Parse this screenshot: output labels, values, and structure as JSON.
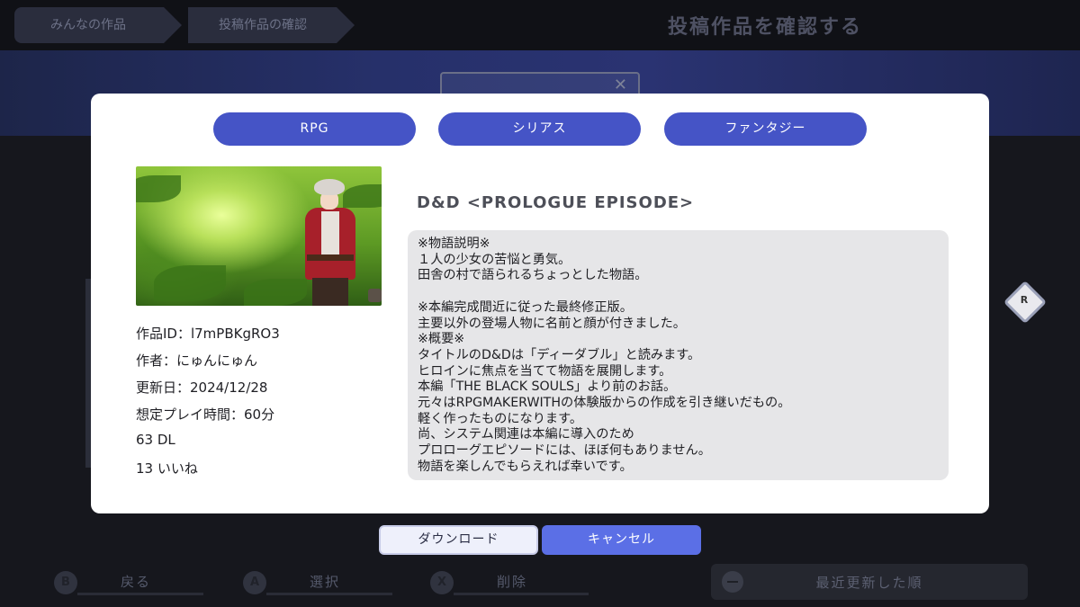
{
  "breadcrumbs": [
    "みんなの作品",
    "投稿作品の確認"
  ],
  "page_title": "投稿作品を確認する",
  "next_page_hint": "R",
  "tags": [
    "RPG",
    "シリアス",
    "ファンタジー"
  ],
  "work": {
    "id_line": "作品ID：l7mPBKgRO3",
    "author_line": "作者：にゅんにゅん",
    "updated_line": "更新日：2024/12/28",
    "playtime_line": "想定プレイ時間：60分",
    "downloads_line": "63 DL",
    "likes_line": "13 いいね",
    "title": "D&D <PROLOGUE EPISODE>",
    "description": "※物語説明※\n１人の少女の苦悩と勇気。\n田舎の村で語られるちょっとした物語。\n\n※本編完成間近に従った最終修正版。\n主要以外の登場人物に名前と顔が付きました。\n※概要※\nタイトルのD&Dは「ディーダブル」と読みます。\nヒロインに焦点を当てて物語を展開します。\n本編「THE BLACK SOULS」より前のお話。\n元々はRPGMAKERWITHの体験版からの作成を引き継いだもの。\n軽く作ったものになります。\n尚、システム関連は本編に導入のため\nプロローグエピソードには、ほぼ何もありません。\n物語を楽しんでもらえれば幸いです。"
  },
  "actions": {
    "download": "ダウンロード",
    "cancel": "キャンセル"
  },
  "bottom_hints": [
    {
      "key": "B",
      "label": "戻る"
    },
    {
      "key": "A",
      "label": "選択"
    },
    {
      "key": "X",
      "label": "削除"
    }
  ],
  "sort_label": "最近更新した順",
  "colors": {
    "tag_bg": "#4554c6",
    "cancel_bg": "#5b6fe6",
    "download_bg": "#eef0fb",
    "modal_bg": "#ffffff",
    "description_bg": "#e6e6e8"
  }
}
